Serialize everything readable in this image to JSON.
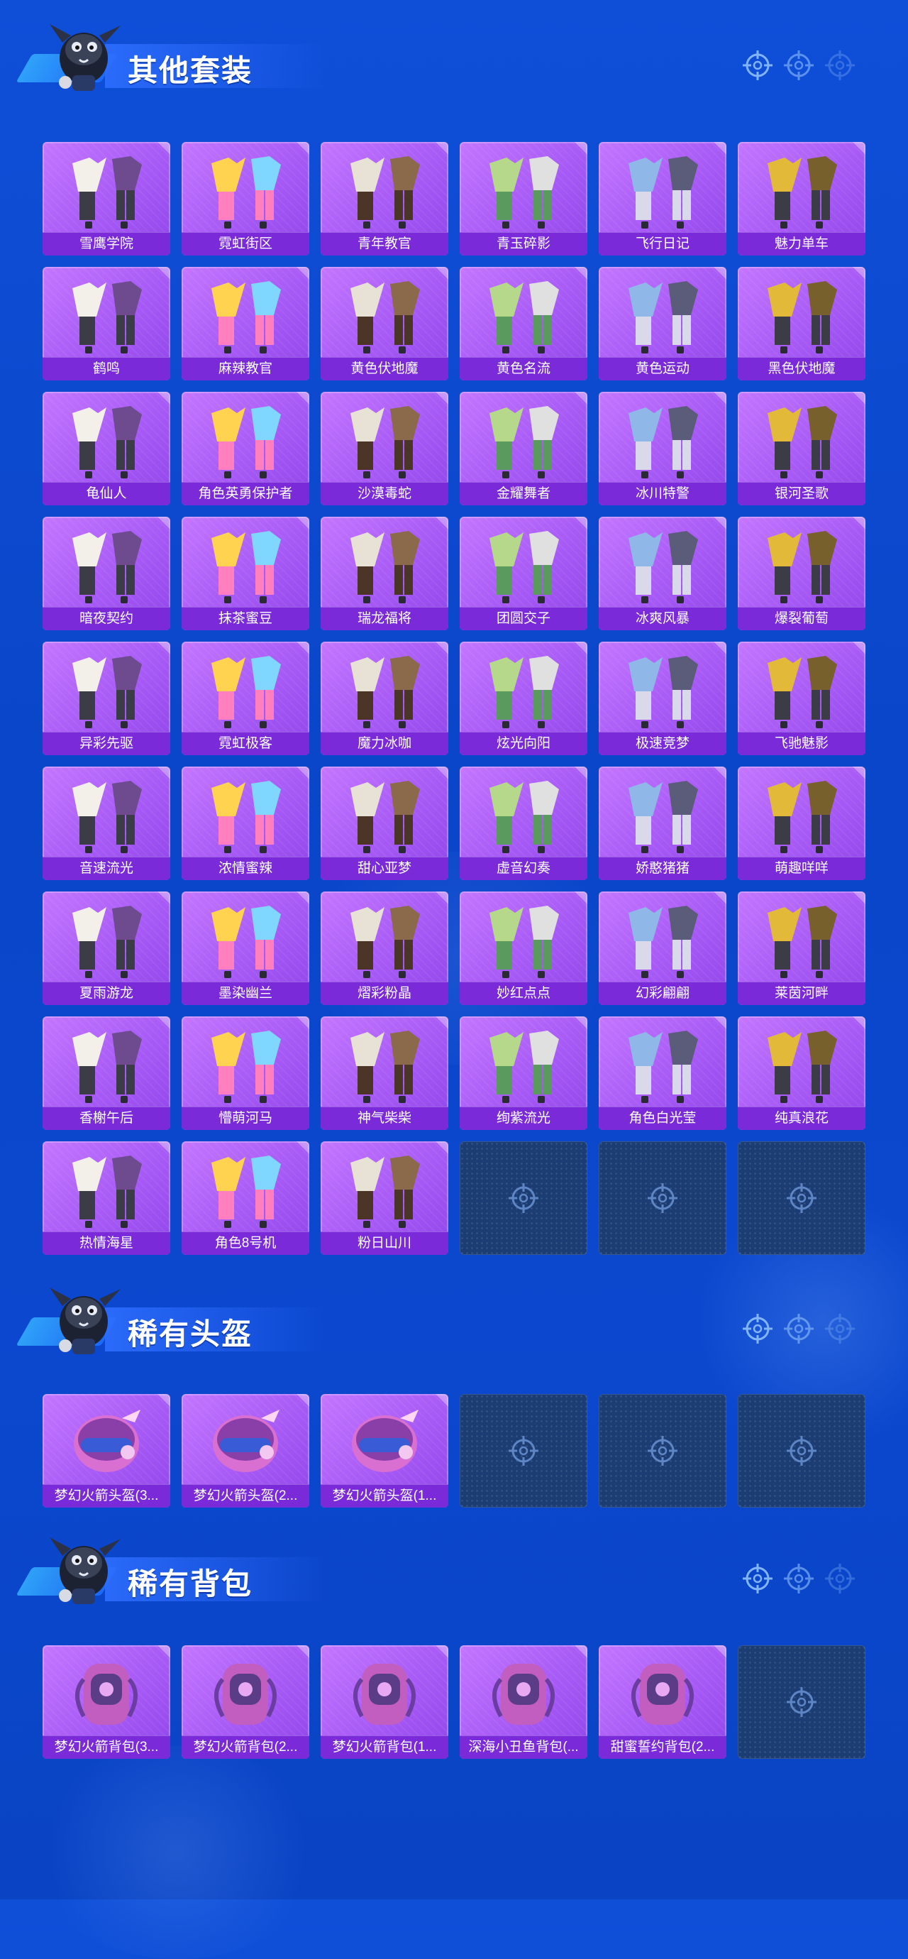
{
  "sections": [
    {
      "title": "其他套装",
      "items": [
        "雪鹰学院",
        "霓虹街区",
        "青年教官",
        "青玉碎影",
        "飞行日记",
        "魅力单车",
        "鹤鸣",
        "麻辣教官",
        "黄色伏地魔",
        "黄色名流",
        "黄色运动",
        "黑色伏地魔",
        "龟仙人",
        "角色英勇保护者",
        "沙漠毒蛇",
        "金耀舞者",
        "冰川特警",
        "银河圣歌",
        "暗夜契约",
        "抹茶蜜豆",
        "瑞龙福将",
        "团圆交子",
        "冰爽风暴",
        "爆裂葡萄",
        "异彩先驱",
        "霓虹极客",
        "魔力冰咖",
        "炫光向阳",
        "极速竞梦",
        "飞驰魅影",
        "音速流光",
        "浓情蜜辣",
        "甜心亚梦",
        "虚音幻奏",
        "娇憨猪猪",
        "萌趣咩咩",
        "夏雨游龙",
        "墨染幽兰",
        "熠彩粉晶",
        "妙红点点",
        "幻彩翩翩",
        "莱茵河畔",
        "香榭午后",
        "懵萌河马",
        "神气柴柴",
        "绚紫流光",
        "角色白光莹",
        "纯真浪花",
        "热情海星",
        "角色8号机",
        "粉日山川"
      ],
      "empty_slots": 3
    },
    {
      "title": "稀有头盔",
      "items": [
        "梦幻火箭头盔(3...",
        "梦幻火箭头盔(2...",
        "梦幻火箭头盔(1..."
      ],
      "empty_slots": 3
    },
    {
      "title": "稀有背包",
      "items": [
        "梦幻火箭背包(3...",
        "梦幻火箭背包(2...",
        "梦幻火箭背包(1...",
        "深海小丑鱼背包(...",
        "甜蜜誓约背包(2..."
      ],
      "empty_slots": 1
    }
  ],
  "colors": {
    "background": "#0b48cf",
    "card_purple": "#a75af5",
    "label_purple": "#7a2ad8",
    "empty_slot": "#1b3d74"
  }
}
